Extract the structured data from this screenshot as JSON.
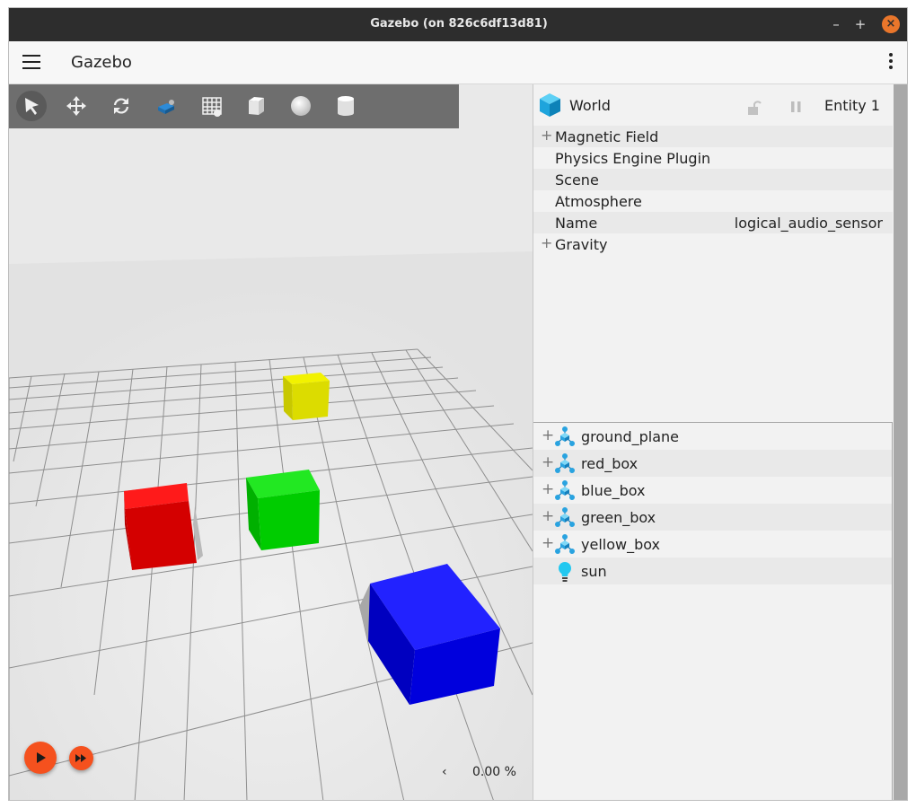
{
  "window": {
    "title": "Gazebo (on 826c6df13d81)",
    "minimize": "–",
    "maximize": "+",
    "close": "×"
  },
  "app": {
    "title": "Gazebo"
  },
  "toolbar": {
    "tools": [
      "select",
      "translate",
      "rotate",
      "transform-control",
      "grid-config",
      "box-shape",
      "sphere-shape",
      "cylinder-shape"
    ]
  },
  "component_inspector": {
    "entity_name": "World",
    "entity_id": "Entity 1",
    "rows": [
      {
        "label": "Magnetic Field",
        "expandable": true
      },
      {
        "label": "Physics Engine Plugin",
        "expandable": false
      },
      {
        "label": "Scene",
        "expandable": false
      },
      {
        "label": "Atmosphere",
        "expandable": false
      },
      {
        "label": "Name",
        "value": "logical_audio_sensor",
        "expandable": false
      },
      {
        "label": "Gravity",
        "expandable": true
      }
    ]
  },
  "entity_tree": {
    "items": [
      {
        "label": "ground_plane",
        "icon": "model-icon",
        "expandable": true
      },
      {
        "label": "red_box",
        "icon": "model-icon",
        "expandable": true
      },
      {
        "label": "blue_box",
        "icon": "model-icon",
        "expandable": true
      },
      {
        "label": "green_box",
        "icon": "model-icon",
        "expandable": true
      },
      {
        "label": "yellow_box",
        "icon": "model-icon",
        "expandable": true
      },
      {
        "label": "sun",
        "icon": "light-icon",
        "expandable": false
      }
    ]
  },
  "playback": {
    "real_time_factor": "0.00 %",
    "rtf_toggle": "‹"
  },
  "colors": {
    "accent": "#f5511e",
    "red_box": "#d40000",
    "green_box": "#00cc00",
    "blue_box": "#0000dd",
    "yellow_box": "#dddd00"
  }
}
